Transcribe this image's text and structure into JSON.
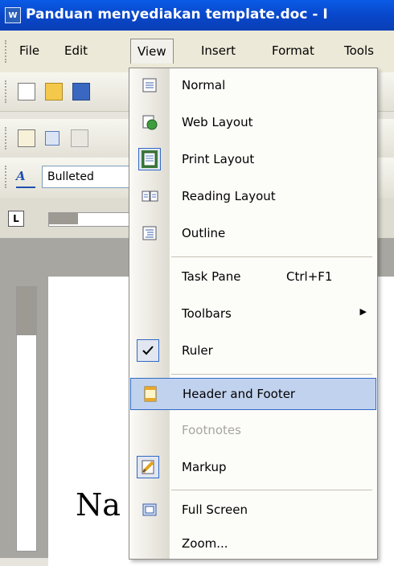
{
  "window": {
    "icon_text": "W",
    "title": "Panduan menyediakan template.doc - I"
  },
  "menubar": {
    "items": [
      "File",
      "Edit",
      "View",
      "Insert",
      "Format",
      "Tools"
    ],
    "active": "View"
  },
  "toolbar": {
    "style_value": "Bulleted"
  },
  "ruler": {
    "tab_selector": "L"
  },
  "document": {
    "visible_text": "Na",
    "visible_text_right": ":"
  },
  "view_menu": {
    "items": [
      {
        "label": "Normal",
        "icon": "normal-view-icon"
      },
      {
        "label": "Web Layout",
        "icon": "web-layout-icon"
      },
      {
        "label": "Print Layout",
        "icon": "print-layout-icon",
        "checked": true
      },
      {
        "label": "Reading Layout",
        "icon": "reading-layout-icon"
      },
      {
        "label": "Outline",
        "icon": "outline-view-icon"
      },
      {
        "label": "Task Pane",
        "shortcut": "Ctrl+F1"
      },
      {
        "label": "Toolbars",
        "submenu": true
      },
      {
        "label": "Ruler",
        "icon": "checkmark-icon",
        "checked": true
      },
      {
        "label": "Header and Footer",
        "icon": "header-footer-icon",
        "highlighted": true
      },
      {
        "label": "Footnotes",
        "disabled": true
      },
      {
        "label": "Markup",
        "icon": "markup-icon",
        "checked": true
      },
      {
        "label": "Full Screen",
        "icon": "full-screen-icon"
      },
      {
        "label": "Zoom...",
        "icon": ""
      }
    ]
  },
  "colors": {
    "titlebar": "#0a5be6",
    "highlight_bg": "#c1d2ee",
    "highlight_border": "#316ac5",
    "disabled_text": "#a7a59d"
  }
}
